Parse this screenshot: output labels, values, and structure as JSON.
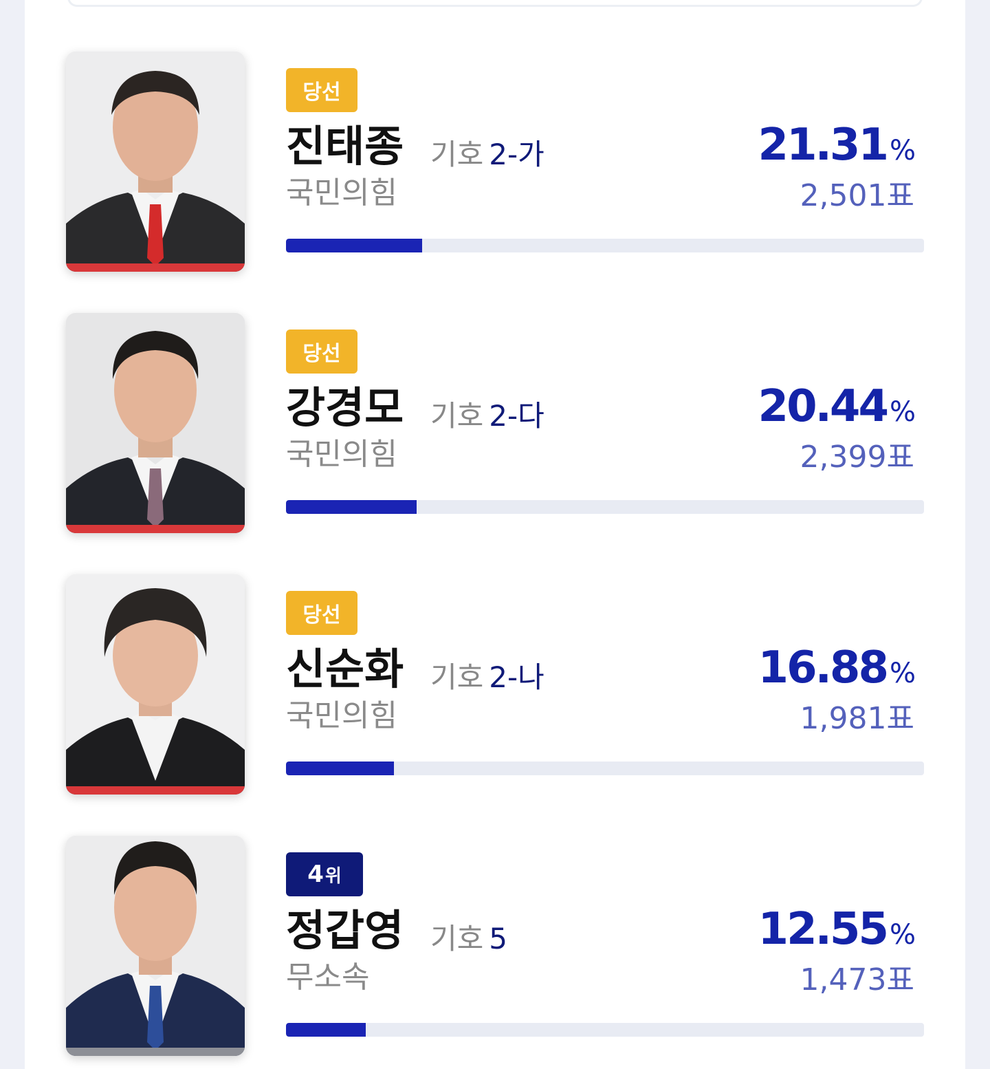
{
  "candidates": [
    {
      "badge": "당선",
      "badge_type": "elected",
      "name": "진태종",
      "ballot_label": "기호",
      "ballot_number": "2-가",
      "party": "국민의힘",
      "percent": "21.31",
      "percent_sign": "%",
      "votes": "2,501표",
      "share": 0.2131,
      "stripe_color": "#d9383a",
      "tie_color": "#d42b2b",
      "suit_color": "#2a2a2c"
    },
    {
      "badge": "당선",
      "badge_type": "elected",
      "name": "강경모",
      "ballot_label": "기호",
      "ballot_number": "2-다",
      "party": "국민의힘",
      "percent": "20.44",
      "percent_sign": "%",
      "votes": "2,399표",
      "share": 0.2044,
      "stripe_color": "#d9383a",
      "tie_color": "#8a6a7a",
      "suit_color": "#23252b"
    },
    {
      "badge": "당선",
      "badge_type": "elected",
      "name": "신순화",
      "ballot_label": "기호",
      "ballot_number": "2-나",
      "party": "국민의힘",
      "percent": "16.88",
      "percent_sign": "%",
      "votes": "1,981표",
      "share": 0.1688,
      "stripe_color": "#d9383a",
      "tie_color": "#f4f4f4",
      "suit_color": "#1d1d1f"
    },
    {
      "badge_num": "4",
      "badge_unit": "위",
      "badge_type": "rank",
      "name": "정갑영",
      "ballot_label": "기호",
      "ballot_number": "5",
      "party": "무소속",
      "percent": "12.55",
      "percent_sign": "%",
      "votes": "1,473표",
      "share": 0.1255,
      "stripe_color": "#8d8f96",
      "tie_color": "#2d4e9a",
      "suit_color": "#1f2b4f"
    }
  ]
}
